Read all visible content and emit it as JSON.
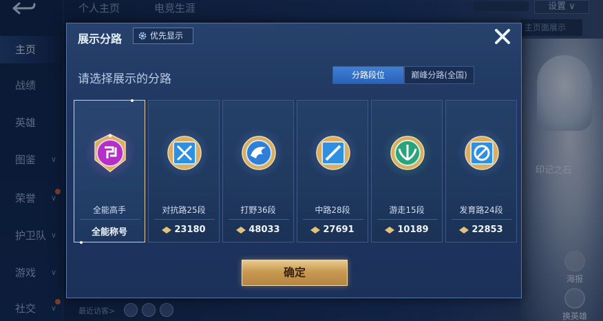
{
  "background": {
    "sidebar": {
      "items": [
        {
          "label": "主页",
          "active": true
        },
        {
          "label": "战绩"
        },
        {
          "label": "英雄"
        },
        {
          "label": "图鉴",
          "has_chevron": true
        },
        {
          "label": "荣誉",
          "has_chevron": true,
          "has_dot": true
        },
        {
          "label": "护卫队",
          "has_chevron": true
        },
        {
          "label": "游戏",
          "has_chevron": true
        },
        {
          "label": "社交",
          "has_chevron": true,
          "has_dot": true
        }
      ]
    },
    "tabs": [
      "个人主页",
      "电竞生涯"
    ],
    "settings_label": "设置",
    "right_button_label": "主页面展示",
    "hero_caption": "印记之石",
    "poster_label": "海报",
    "change_hero_label": "换英雄",
    "visitor_label": "最近访客>"
  },
  "modal": {
    "title": "展示分路",
    "priority_label": "优先显示",
    "subtitle": "请选择展示的分路",
    "segments": [
      {
        "label": "分路段位",
        "active": true
      },
      {
        "label": "巅峰分路(全国)",
        "active": false
      }
    ],
    "cards": [
      {
        "role": "全能高手",
        "bottom": "全能称号",
        "score": null,
        "selected": true,
        "emblem": "all-round-emblem",
        "color": "#c23ad0"
      },
      {
        "role": "对抗路25段",
        "score": "23180",
        "selected": false,
        "emblem": "clash-lane-emblem",
        "color": "#2f8fe0"
      },
      {
        "role": "打野36段",
        "score": "48033",
        "selected": false,
        "emblem": "jungle-emblem",
        "color": "#2f7fd8"
      },
      {
        "role": "中路28段",
        "score": "27691",
        "selected": false,
        "emblem": "mid-lane-emblem",
        "color": "#2f8fe0"
      },
      {
        "role": "游走15段",
        "score": "10189",
        "selected": false,
        "emblem": "roam-emblem",
        "color": "#2aa37a"
      },
      {
        "role": "发育路24段",
        "score": "22853",
        "selected": false,
        "emblem": "farm-lane-emblem",
        "color": "#2f8fe0"
      }
    ],
    "confirm_label": "确定",
    "colors": {
      "accent": "#3e7fd6",
      "gold": "#d6ad6a",
      "card_border_selected": "#e8cfa2"
    }
  }
}
